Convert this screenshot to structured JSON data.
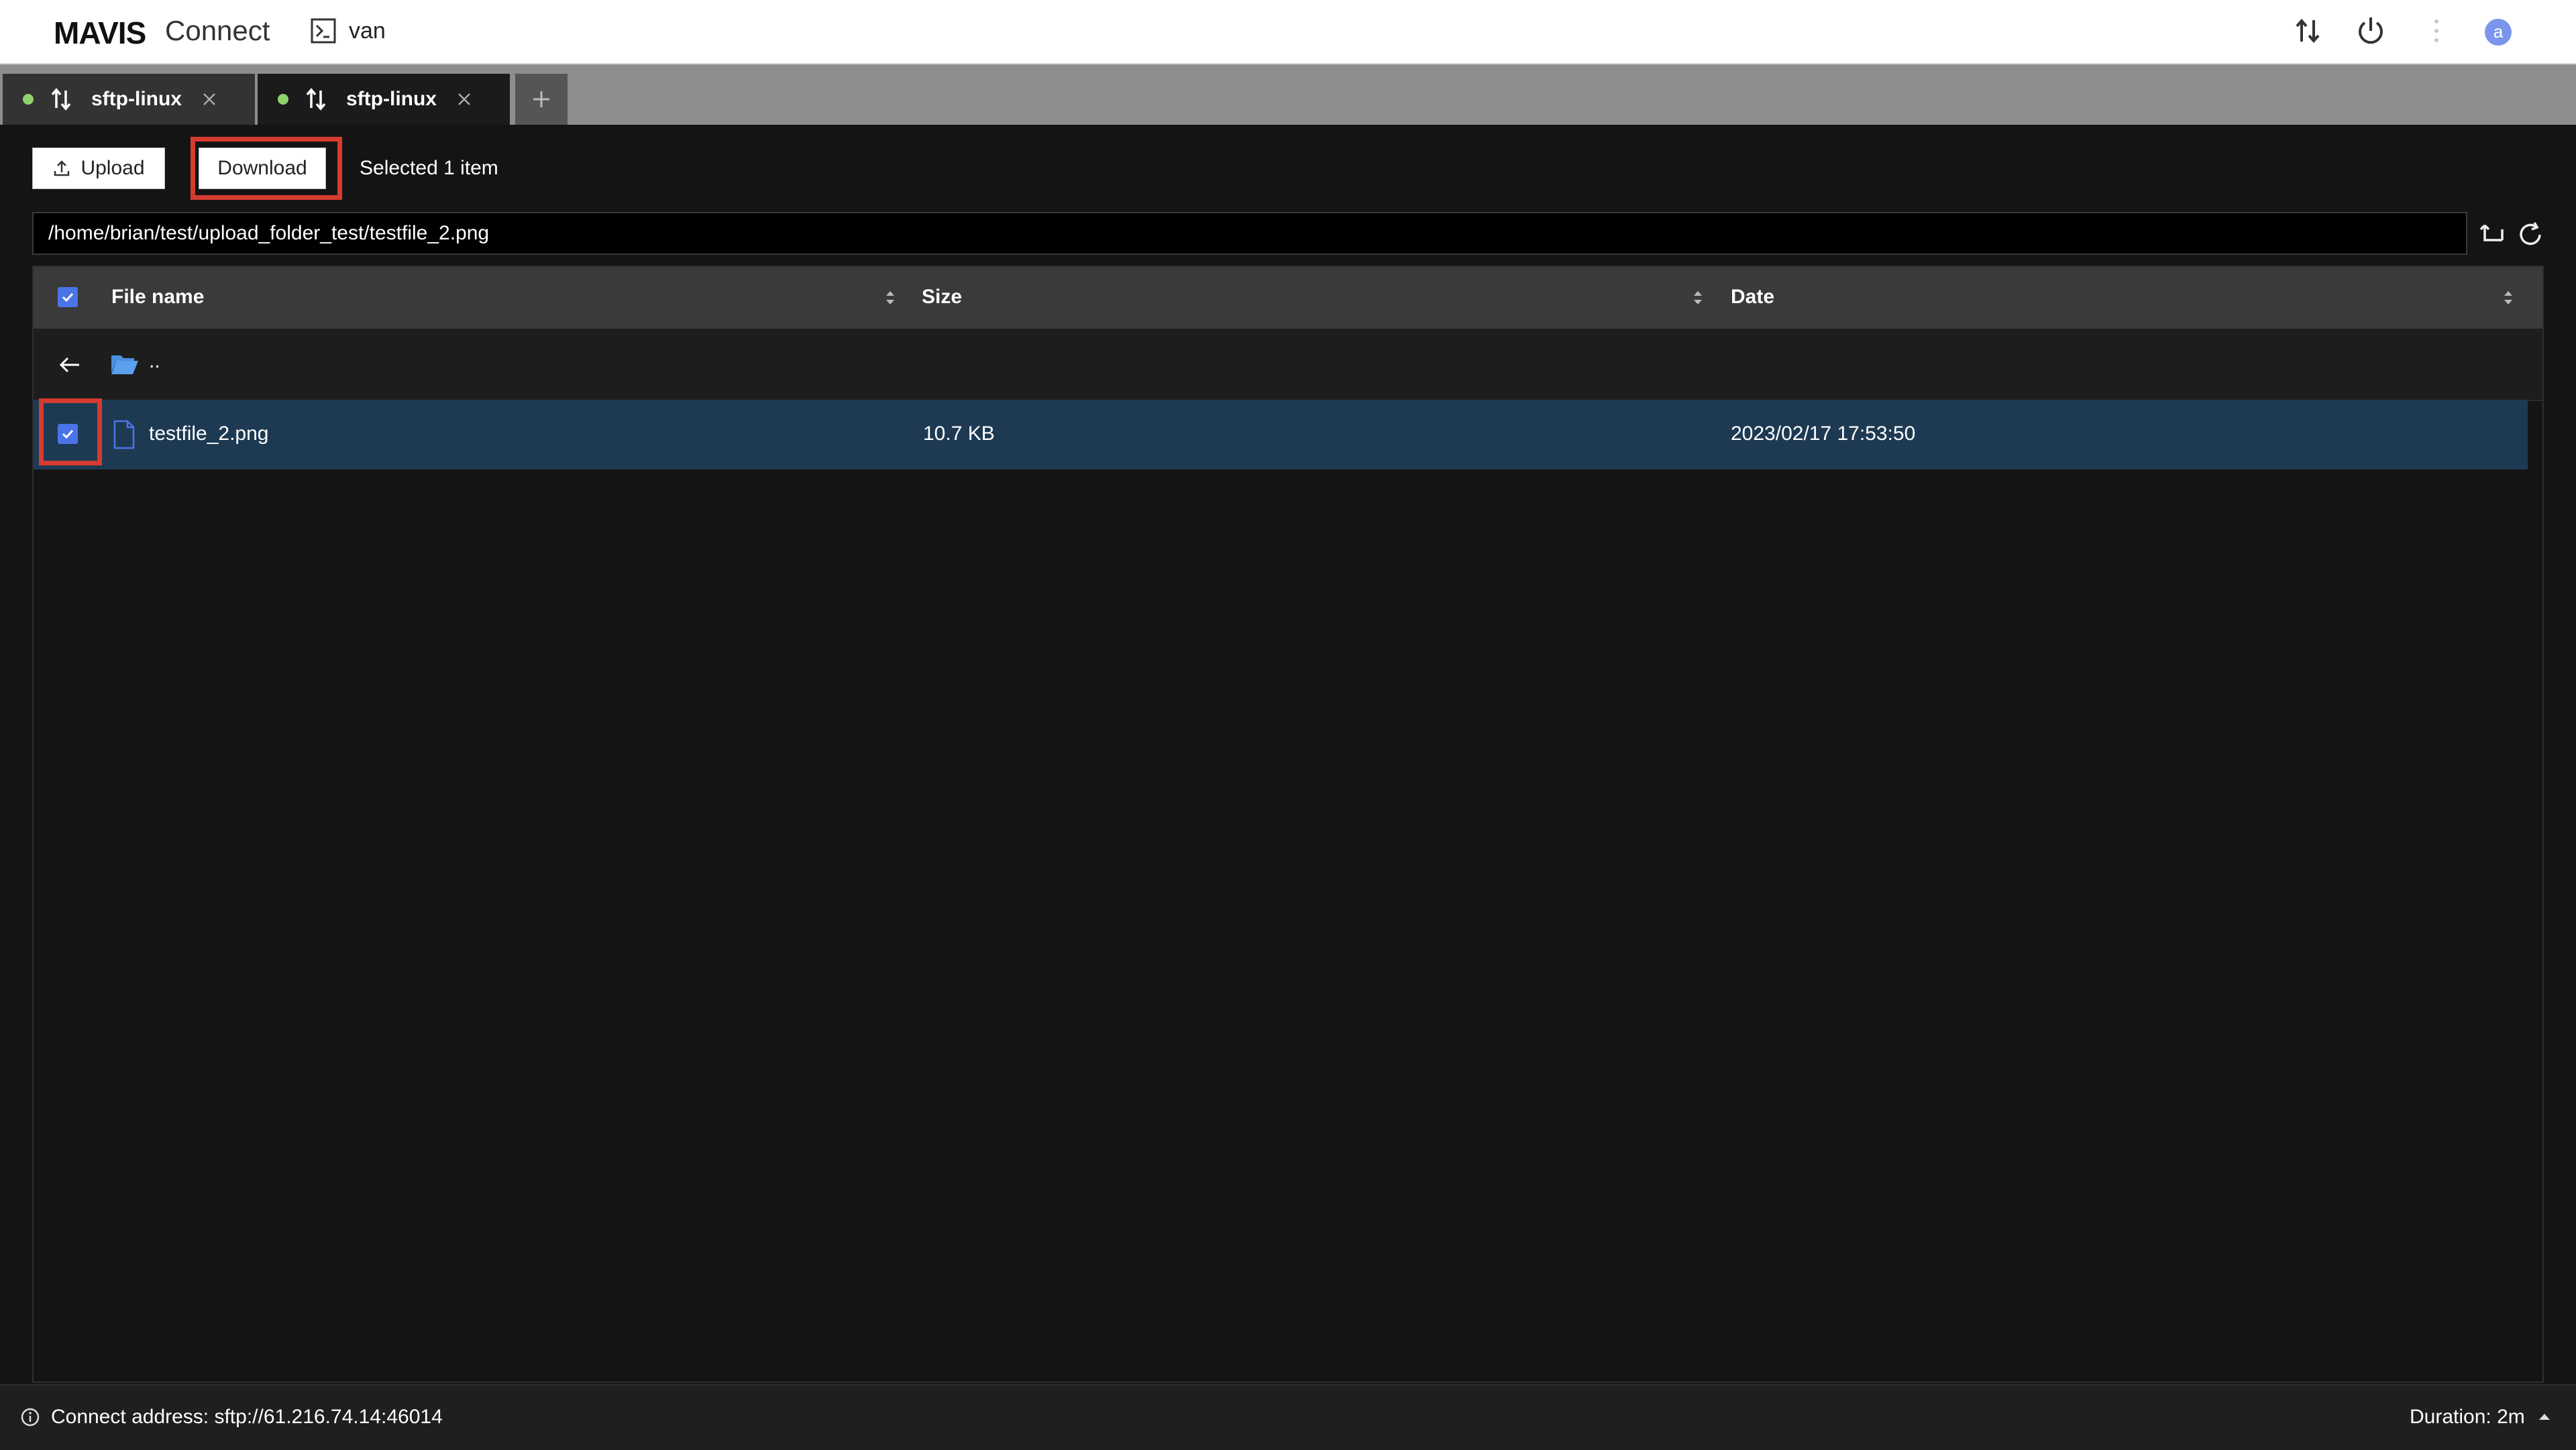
{
  "header": {
    "logo": "MAVIS",
    "brand": "Connect",
    "session_name": "van",
    "avatar_initial": "a",
    "icons": [
      "terminal-icon",
      "transfer-icon",
      "power-icon",
      "more-vertical-icon"
    ]
  },
  "tabs": [
    {
      "label": "sftp-linux",
      "active": false,
      "status": "connected"
    },
    {
      "label": "sftp-linux",
      "active": true,
      "status": "connected"
    }
  ],
  "toolbar": {
    "upload_label": "Upload",
    "download_label": "Download",
    "selection_text": "Selected 1 item"
  },
  "path": {
    "value": "/home/brian/test/upload_folder_test/testfile_2.png"
  },
  "table": {
    "columns": [
      "File name",
      "Size",
      "Date"
    ],
    "parent_dir": "..",
    "rows": [
      {
        "name": "testfile_2.png",
        "size": "10.7 KB",
        "date": "2023/02/17 17:53:50",
        "selected": true
      }
    ]
  },
  "status": {
    "address": "Connect address: sftp://61.216.74.14:46014",
    "duration": "Duration: 2m"
  },
  "colors": {
    "accent": "#4a74e8",
    "selected_row": "#1e3a53",
    "highlight": "#d63b2f",
    "status_dot": "#8fd36d"
  }
}
